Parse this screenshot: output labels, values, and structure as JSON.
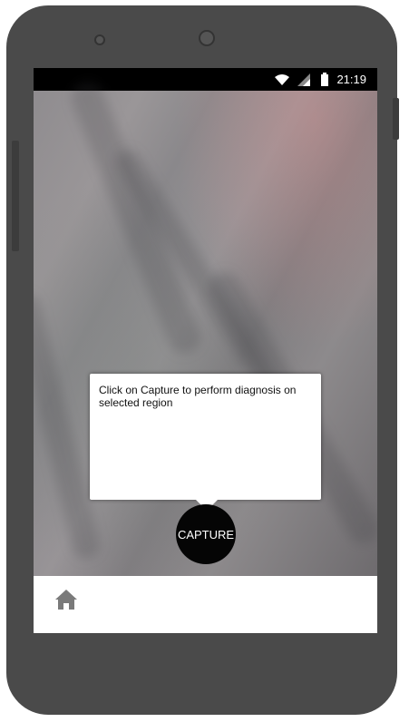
{
  "status_bar": {
    "time": "21:19",
    "icons": [
      "wifi-icon",
      "signal-icon",
      "battery-icon"
    ]
  },
  "tooltip": {
    "text": "Click on Capture to perform diagnosis on selected region"
  },
  "capture_button": {
    "label": "CAPTURE"
  },
  "bottom_nav": {
    "icon": "home-icon"
  },
  "colors": {
    "phone_body": "#4a4a4a",
    "capture_bg": "#050505",
    "home_icon": "#7a7a7a"
  }
}
